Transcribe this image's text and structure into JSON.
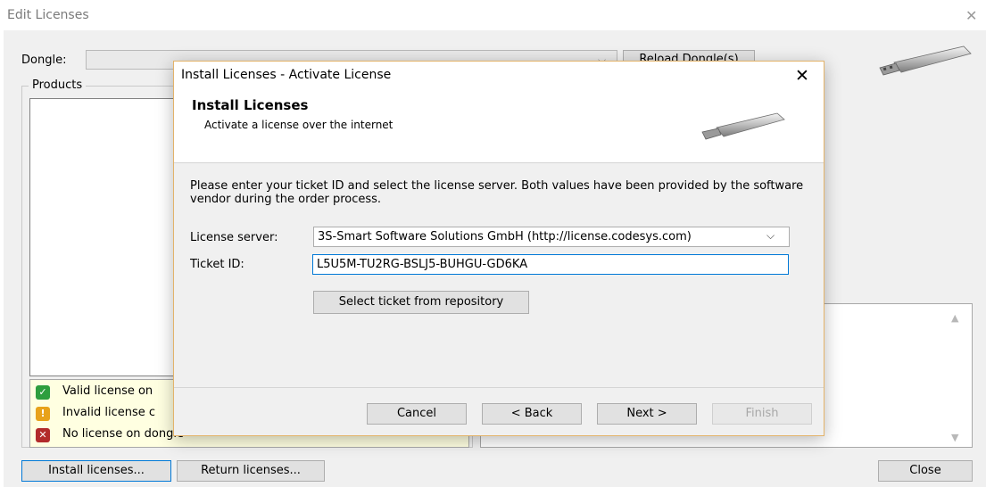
{
  "outer": {
    "title": "Edit Licenses",
    "close_glyph": "✕",
    "dongle_label": "Dongle:",
    "reload_label": "Reload Dongle(s)",
    "products_label": "Products",
    "legend": [
      {
        "text": "Valid license on",
        "icon": "check-icon",
        "glyph": "✓",
        "color": "#2e9e3e"
      },
      {
        "text": "Invalid license c",
        "icon": "warning-icon",
        "glyph": "!",
        "color": "#e8a21b"
      },
      {
        "text": "No license on dongle",
        "icon": "error-icon",
        "glyph": "✕",
        "color": "#b22b2b"
      }
    ],
    "install_label": "Install licenses...",
    "return_label": "Return licenses...",
    "close_label": "Close"
  },
  "dialog": {
    "title": "Install Licenses - Activate License",
    "close_glyph": "✕",
    "header_title": "Install Licenses",
    "header_subtitle": "Activate a license over the internet",
    "instruction": "Please enter your ticket ID and select the license server. Both values have been provided by the software vendor during the order process.",
    "server_label": "License server:",
    "server_value": "3S-Smart Software Solutions GmbH (http://license.codesys.com)",
    "ticket_label": "Ticket ID:",
    "ticket_value": "L5U5M-TU2RG-BSLJ5-BUHGU-GD6KA",
    "select_ticket_label": "Select ticket from repository",
    "cancel_label": "Cancel",
    "back_label": "< Back",
    "next_label": "Next >",
    "finish_label": "Finish"
  }
}
